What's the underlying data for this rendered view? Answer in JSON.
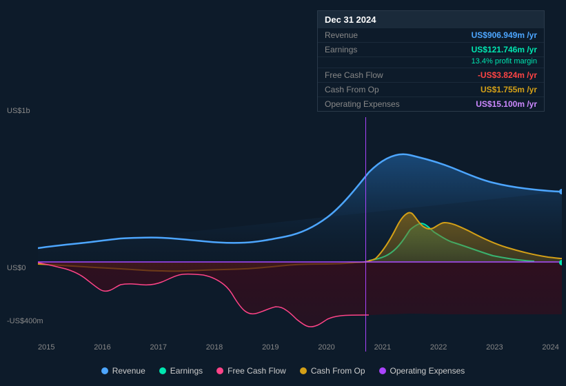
{
  "tooltip": {
    "date": "Dec 31 2024",
    "rows": [
      {
        "label": "Revenue",
        "value": "US$906.949m /yr",
        "color": "val-blue"
      },
      {
        "label": "Earnings",
        "value": "US$121.746m /yr",
        "color": "val-green"
      },
      {
        "label": "profit_margin",
        "value": "13.4% profit margin",
        "color": "val-green"
      },
      {
        "label": "Free Cash Flow",
        "value": "-US$3.824m /yr",
        "color": "val-red"
      },
      {
        "label": "Cash From Op",
        "value": "US$1.755m /yr",
        "color": "val-yellow"
      },
      {
        "label": "Operating Expenses",
        "value": "US$15.100m /yr",
        "color": "val-purple"
      }
    ]
  },
  "yLabels": {
    "top": "US$1b",
    "zero": "US$0",
    "bottom": "-US$400m"
  },
  "xLabels": [
    "2015",
    "2016",
    "2017",
    "2018",
    "2019",
    "2020",
    "2021",
    "2022",
    "2023",
    "2024"
  ],
  "legend": [
    {
      "label": "Revenue",
      "color": "#4da6ff"
    },
    {
      "label": "Earnings",
      "color": "#00e6b0"
    },
    {
      "label": "Free Cash Flow",
      "color": "#ff4488"
    },
    {
      "label": "Cash From Op",
      "color": "#d4a017"
    },
    {
      "label": "Operating Expenses",
      "color": "#aa44ff"
    }
  ]
}
